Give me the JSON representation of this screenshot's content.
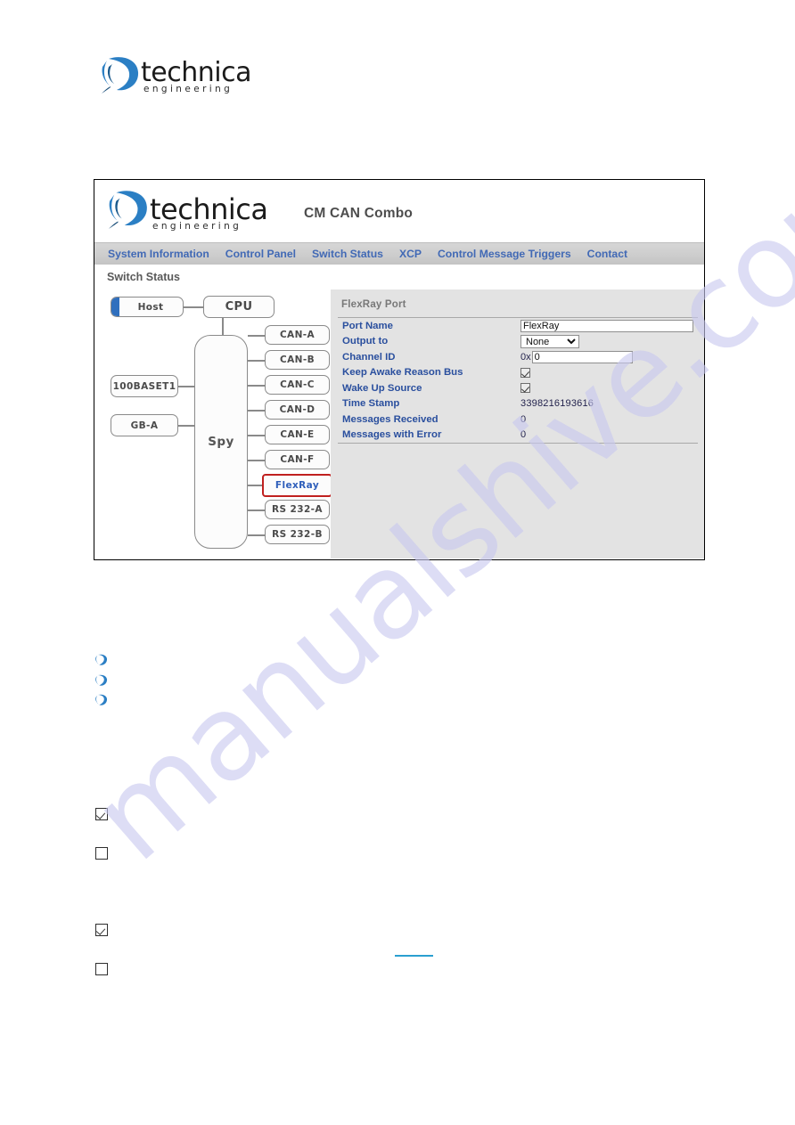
{
  "brand": {
    "name": "technica",
    "tagline": "engineering",
    "mark": "technica-swirl-logo"
  },
  "device_ui": {
    "title": "CM CAN Combo",
    "nav": [
      {
        "label": "System Information",
        "name": "nav-system-information"
      },
      {
        "label": "Control Panel",
        "name": "nav-control-panel"
      },
      {
        "label": "Switch Status",
        "name": "nav-switch-status"
      },
      {
        "label": "XCP",
        "name": "nav-xcp"
      },
      {
        "label": "Control Message Triggers",
        "name": "nav-control-message-triggers"
      },
      {
        "label": "Contact",
        "name": "nav-contact"
      }
    ],
    "section_title": "Switch Status",
    "topology": {
      "host": "Host",
      "cpu": "CPU",
      "spy": "Spy",
      "left_ports": [
        "100BASET1",
        "GB-A"
      ],
      "right_ports": [
        "CAN-A",
        "CAN-B",
        "CAN-C",
        "CAN-D",
        "CAN-E",
        "CAN-F",
        "FlexRay",
        "RS 232-A",
        "RS 232-B"
      ],
      "selected_port": "FlexRay",
      "selection_color": "#c0201f",
      "host_accent_color": "#2f6fbe"
    },
    "port_panel": {
      "legend": "FlexRay Port",
      "rows": [
        {
          "label": "Port Name",
          "type": "text",
          "value": "FlexRay"
        },
        {
          "label": "Output to",
          "type": "select",
          "value": "None"
        },
        {
          "label": "Channel ID",
          "type": "hex",
          "prefix": "0x",
          "value": "0"
        },
        {
          "label": "Keep Awake Reason Bus",
          "type": "checkbox",
          "value": "checked"
        },
        {
          "label": "Wake Up Source",
          "type": "checkbox",
          "value": "checked"
        },
        {
          "label": "Time Stamp",
          "type": "static",
          "value": "3398216193616"
        },
        {
          "label": "Messages Received",
          "type": "static",
          "value": "0"
        },
        {
          "label": "Messages with Error",
          "type": "static",
          "value": "0"
        }
      ],
      "label_color": "#2a4f9e"
    }
  },
  "document_marks": {
    "bullets": [
      "list-bullet-1",
      "list-bullet-2",
      "list-bullet-3"
    ],
    "checkboxes": [
      {
        "name": "doc-checkbox-1",
        "state": "checked"
      },
      {
        "name": "doc-checkbox-2",
        "state": "unchecked"
      },
      {
        "name": "doc-checkbox-3",
        "state": "checked"
      },
      {
        "name": "doc-checkbox-4",
        "state": "unchecked"
      }
    ]
  },
  "watermark": {
    "text": "manualshive.com",
    "color": "#c9c9ef"
  }
}
